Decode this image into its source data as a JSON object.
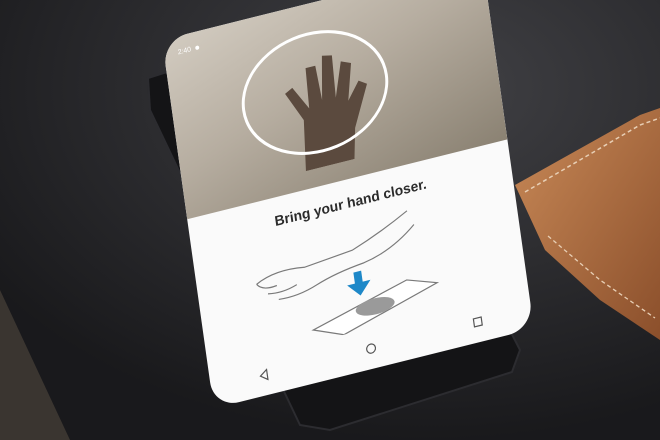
{
  "screen": {
    "status_time": "2:40",
    "instruction_text": "Bring your hand closer."
  },
  "nav": {
    "back_icon": "back-triangle-icon",
    "home_icon": "home-circle-icon",
    "recents_icon": "recents-square-icon"
  },
  "colors": {
    "accent_arrow": "#1e88c8",
    "ring": "#ffffff"
  }
}
